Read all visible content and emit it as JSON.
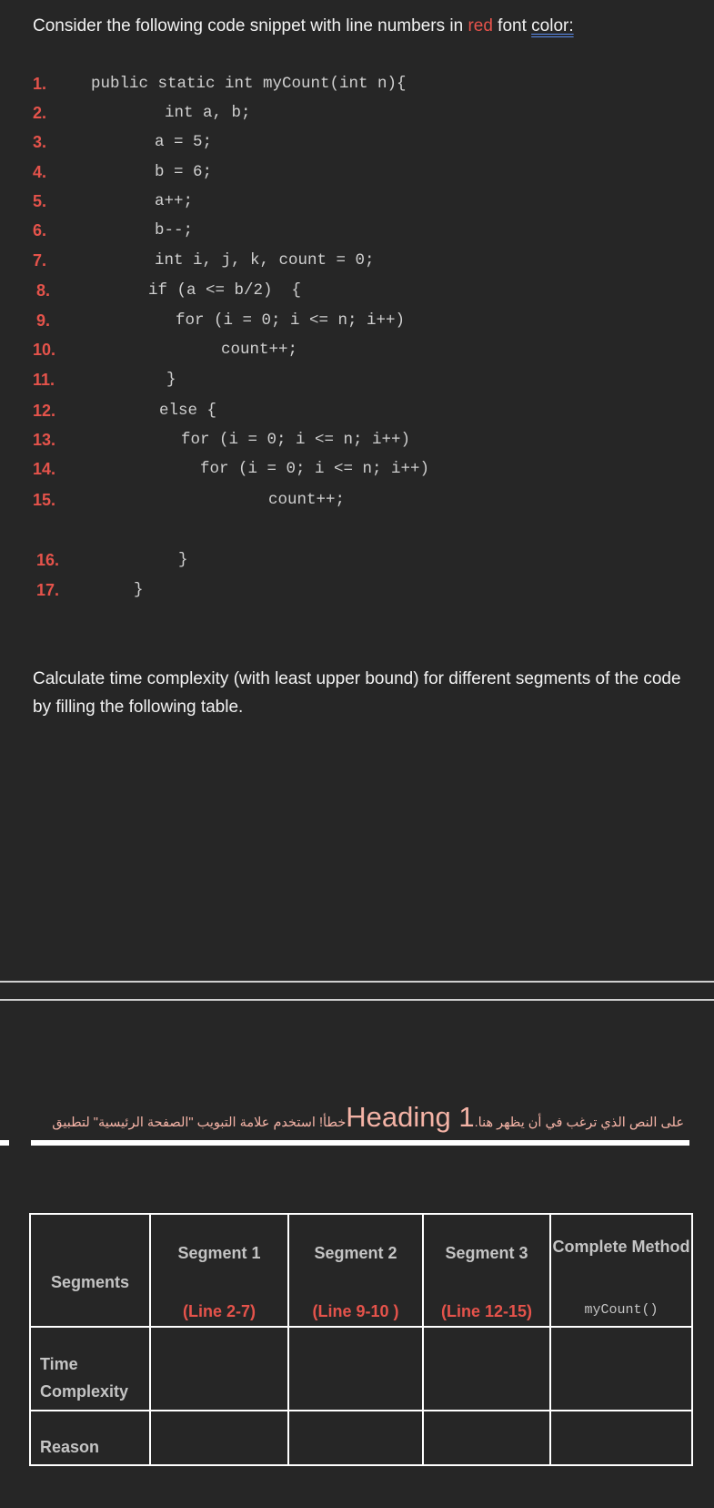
{
  "intro": {
    "before": "Consider the following code snippet with line numbers in ",
    "red_word": "red",
    "middle": " font ",
    "underlined": "color:"
  },
  "code": {
    "lines": [
      {
        "num": "1.",
        "text": "public static int myCount(int n){"
      },
      {
        "num": "2.",
        "text": "int a, b;"
      },
      {
        "num": "3.",
        "text": "a = 5;"
      },
      {
        "num": "4.",
        "text": "b = 6;"
      },
      {
        "num": "5.",
        "text": "a++;"
      },
      {
        "num": "6.",
        "text": "b--;"
      },
      {
        "num": "7.",
        "text": "int i, j, k, count = 0;"
      },
      {
        "num": "8.",
        "text": "if (a <= b/2)  {"
      },
      {
        "num": "9.",
        "text": "for (i = 0; i <= n; i++)"
      },
      {
        "num": "10.",
        "text": "count++;"
      },
      {
        "num": "11.",
        "text": "}"
      },
      {
        "num": "12.",
        "text": "else {"
      },
      {
        "num": "13.",
        "text": "for (i = 0; i <= n; i++)"
      },
      {
        "num": "14.",
        "text": "for (i = 0; i <= n; i++)"
      },
      {
        "num": "15.",
        "text": "count++;"
      },
      {
        "num": "16.",
        "text": "}"
      },
      {
        "num": "17.",
        "text": "}"
      }
    ]
  },
  "task": {
    "text": "Calculate time complexity (with least upper bound) for different segments of the code by filling the following table."
  },
  "heading_error": {
    "arabic_right": "على النص الذي ترغب في أن يظهر هنا.",
    "big": "Heading 1",
    "arabic_left": "خطأ! استخدم علامة التبويب \"الصفحة الرئيسية\" لتطبيق"
  },
  "table": {
    "header": {
      "label": "Segments",
      "columns": [
        {
          "title": "Segment 1",
          "sub": "(Line 2-7)"
        },
        {
          "title": "Segment 2",
          "sub": "(Line 9-10 )"
        },
        {
          "title": "Segment 3",
          "sub": "(Line 12-15)"
        },
        {
          "title": "Complete Method",
          "sub": "myCount()"
        }
      ]
    },
    "rows": [
      {
        "label": "Time Complexity",
        "cells": [
          "",
          "",
          "",
          ""
        ]
      },
      {
        "label": "Reason",
        "cells": [
          "",
          "",
          "",
          ""
        ]
      }
    ]
  },
  "colors": {
    "background": "#262626",
    "line_number_red": "#e5534b",
    "code_gray": "#d0d0d0",
    "heading_error_pink": "#f4b3a6",
    "spell_underline_blue": "#5b8def"
  }
}
